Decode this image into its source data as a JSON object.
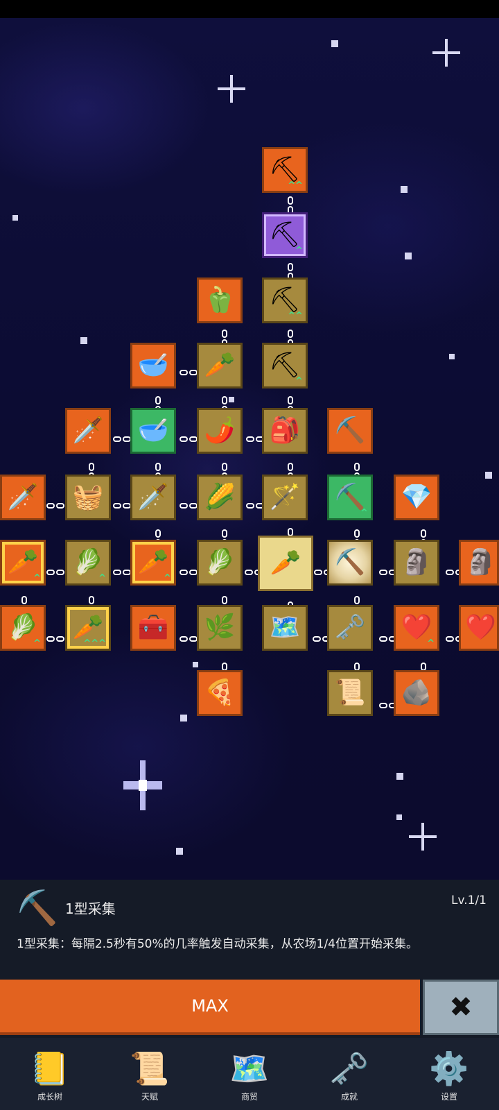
{
  "info": {
    "icon": "pickaxe-icon",
    "title": "1型采集",
    "level": "Lv.1/1",
    "description": "1型采集：每隔2.5秒有50%的几率触发自动采集，从农场1/4位置开始采集。"
  },
  "actions": {
    "max_label": "MAX",
    "close_icon": "close-icon"
  },
  "tabs": [
    {
      "label": "成长树",
      "icon": "book-icon"
    },
    {
      "label": "天赋",
      "icon": "scroll-icon"
    },
    {
      "label": "商贸",
      "icon": "map-icon"
    },
    {
      "label": "成就",
      "icon": "key-icon"
    },
    {
      "label": "设置",
      "icon": "gear-icon"
    }
  ],
  "skill_tree": {
    "selected": "carrot-node",
    "nodes": [
      {
        "icon": "shovel-icon",
        "color": "orange",
        "upgrade": "double"
      },
      {
        "icon": "shovel-icon",
        "color": "purple",
        "upgrade": "single"
      },
      {
        "icon": "pepper-icon",
        "color": "orange"
      },
      {
        "icon": "shovel-icon",
        "color": "gold",
        "upgrade": "double"
      },
      {
        "icon": "bowl-icon",
        "color": "orange"
      },
      {
        "icon": "radish-icon",
        "color": "gold"
      },
      {
        "icon": "shovel-icon",
        "color": "gold",
        "upgrade": "single"
      },
      {
        "icon": "sword-icon",
        "color": "orange"
      },
      {
        "icon": "bowl-icon",
        "color": "green"
      },
      {
        "icon": "chili-icon",
        "color": "gold"
      },
      {
        "icon": "sack-icon",
        "color": "gold"
      },
      {
        "icon": "pickaxe-icon",
        "color": "orange"
      },
      {
        "icon": "sword-icon",
        "color": "orange"
      },
      {
        "icon": "basket-icon",
        "color": "gold"
      },
      {
        "icon": "sword-icon",
        "color": "gold"
      },
      {
        "icon": "corn-icon",
        "color": "gold"
      },
      {
        "icon": "staff-icon",
        "color": "gold"
      },
      {
        "icon": "pickaxe-icon",
        "color": "green",
        "upgrade": "single"
      },
      {
        "icon": "crystal-icon",
        "color": "orange"
      },
      {
        "icon": "carrot-icon",
        "color": "orange",
        "upgrade": "single"
      },
      {
        "icon": "cabbage-icon",
        "color": "gold",
        "upgrade": "single"
      },
      {
        "icon": "carrot-icon",
        "color": "orange",
        "upgrade": "single"
      },
      {
        "icon": "cabbage-icon",
        "color": "gold"
      },
      {
        "icon": "carrot-icon",
        "color": "gold",
        "state": "selected"
      },
      {
        "icon": "pickaxe-icon",
        "color": "gold",
        "state": "glowing"
      },
      {
        "icon": "statue-icon",
        "color": "gold"
      },
      {
        "icon": "statue-icon",
        "color": "orange"
      },
      {
        "icon": "cabbage-icon",
        "color": "orange",
        "upgrade": "single"
      },
      {
        "icon": "carrot-icon",
        "color": "gold",
        "upgrade": "triple"
      },
      {
        "icon": "chest-icon",
        "color": "orange"
      },
      {
        "icon": "leek-icon",
        "color": "gold"
      },
      {
        "icon": "map-icon",
        "color": "gold"
      },
      {
        "icon": "key-icon",
        "color": "gold"
      },
      {
        "icon": "heart-icon",
        "color": "orange",
        "upgrade": "single"
      },
      {
        "icon": "heart-icon",
        "color": "orange"
      },
      {
        "icon": "pizza-icon",
        "color": "orange"
      },
      {
        "icon": "scroll-icon",
        "color": "gold"
      },
      {
        "icon": "ore-icon",
        "color": "orange"
      }
    ]
  }
}
